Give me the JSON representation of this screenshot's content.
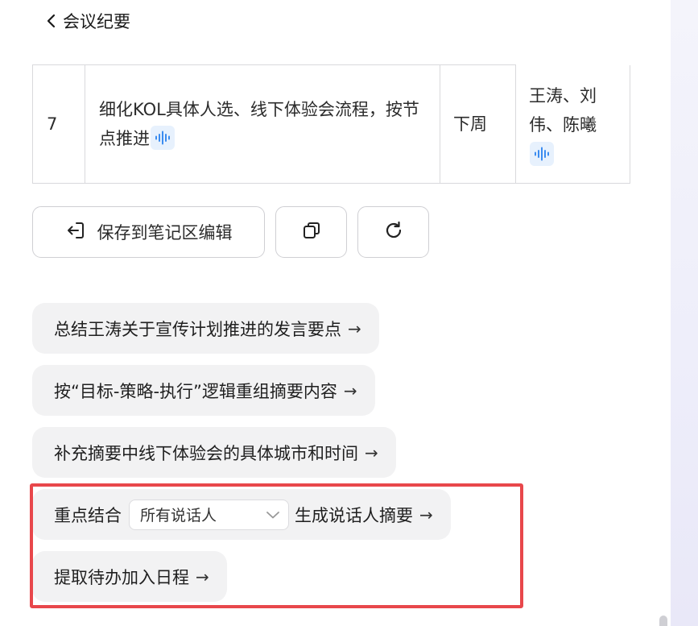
{
  "header": {
    "title": "会议纪要"
  },
  "table": {
    "row": {
      "num": "7",
      "task": "细化KOL具体人选、线下体验会流程，按节点推进",
      "time": "下周",
      "owners": "王涛、刘伟、陈曦"
    }
  },
  "actions": {
    "save_label": "保存到笔记区编辑"
  },
  "suggestions": [
    {
      "text": "总结王涛关于宣传计划推进的发言要点",
      "arrow": "→"
    },
    {
      "text": "按“目标-策略-执行”逻辑重组摘要内容",
      "arrow": "→"
    },
    {
      "text": "补充摘要中线下体验会的具体城市和时间",
      "arrow": "→"
    }
  ],
  "speaker_summary": {
    "prefix": "重点结合",
    "select_value": "所有说话人",
    "suffix": "生成说话人摘要",
    "arrow": "→"
  },
  "todo": {
    "text": "提取待办加入日程",
    "arrow": "→"
  },
  "colors": {
    "highlight": "#e8474b",
    "wave_icon": "#3b8cf0",
    "chip_bg": "#f2f2f3"
  }
}
